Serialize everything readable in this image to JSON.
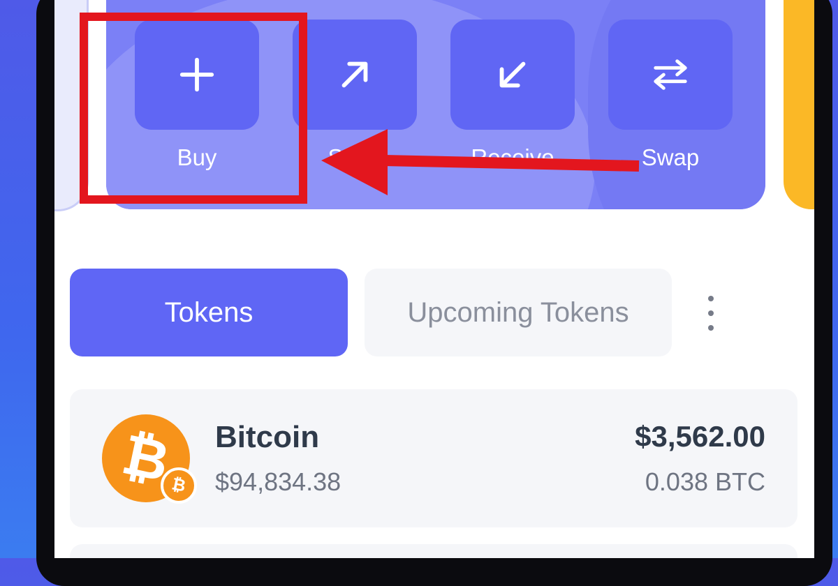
{
  "actions": [
    {
      "label": "Buy",
      "icon": "plus-icon"
    },
    {
      "label": "Send",
      "icon": "arrow-up-right-icon"
    },
    {
      "label": "Receive",
      "icon": "arrow-down-left-icon"
    },
    {
      "label": "Swap",
      "icon": "swap-arrows-icon"
    }
  ],
  "tabs": {
    "active": "Tokens",
    "idle": "Upcoming Tokens"
  },
  "tokens": [
    {
      "name": "Bitcoin",
      "price": "$94,834.38",
      "value": "$3,562.00",
      "amount": "0.038 BTC",
      "symbol": "₿",
      "icon": "bitcoin-icon"
    }
  ],
  "annotation": {
    "color": "#e3161e",
    "target": "Buy"
  },
  "colors": {
    "accent": "#5f66f5",
    "card": "#7b80f6",
    "bitcoin": "#f7931a",
    "next_card": "#fbb826"
  }
}
